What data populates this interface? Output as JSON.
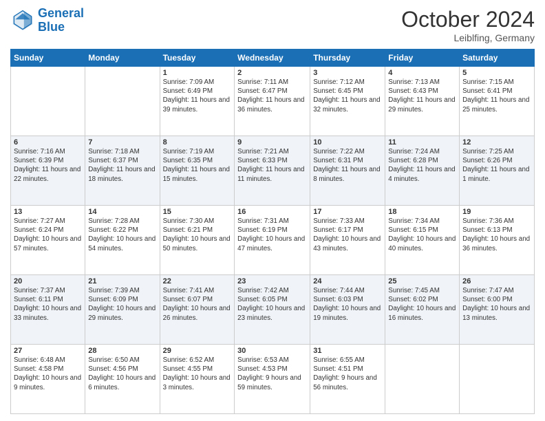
{
  "header": {
    "logo_line1": "General",
    "logo_line2": "Blue",
    "month_title": "October 2024",
    "location": "Leiblfing, Germany"
  },
  "days_of_week": [
    "Sunday",
    "Monday",
    "Tuesday",
    "Wednesday",
    "Thursday",
    "Friday",
    "Saturday"
  ],
  "weeks": [
    [
      {
        "day": "",
        "sunrise": "",
        "sunset": "",
        "daylight": ""
      },
      {
        "day": "",
        "sunrise": "",
        "sunset": "",
        "daylight": ""
      },
      {
        "day": "1",
        "sunrise": "Sunrise: 7:09 AM",
        "sunset": "Sunset: 6:49 PM",
        "daylight": "Daylight: 11 hours and 39 minutes."
      },
      {
        "day": "2",
        "sunrise": "Sunrise: 7:11 AM",
        "sunset": "Sunset: 6:47 PM",
        "daylight": "Daylight: 11 hours and 36 minutes."
      },
      {
        "day": "3",
        "sunrise": "Sunrise: 7:12 AM",
        "sunset": "Sunset: 6:45 PM",
        "daylight": "Daylight: 11 hours and 32 minutes."
      },
      {
        "day": "4",
        "sunrise": "Sunrise: 7:13 AM",
        "sunset": "Sunset: 6:43 PM",
        "daylight": "Daylight: 11 hours and 29 minutes."
      },
      {
        "day": "5",
        "sunrise": "Sunrise: 7:15 AM",
        "sunset": "Sunset: 6:41 PM",
        "daylight": "Daylight: 11 hours and 25 minutes."
      }
    ],
    [
      {
        "day": "6",
        "sunrise": "Sunrise: 7:16 AM",
        "sunset": "Sunset: 6:39 PM",
        "daylight": "Daylight: 11 hours and 22 minutes."
      },
      {
        "day": "7",
        "sunrise": "Sunrise: 7:18 AM",
        "sunset": "Sunset: 6:37 PM",
        "daylight": "Daylight: 11 hours and 18 minutes."
      },
      {
        "day": "8",
        "sunrise": "Sunrise: 7:19 AM",
        "sunset": "Sunset: 6:35 PM",
        "daylight": "Daylight: 11 hours and 15 minutes."
      },
      {
        "day": "9",
        "sunrise": "Sunrise: 7:21 AM",
        "sunset": "Sunset: 6:33 PM",
        "daylight": "Daylight: 11 hours and 11 minutes."
      },
      {
        "day": "10",
        "sunrise": "Sunrise: 7:22 AM",
        "sunset": "Sunset: 6:31 PM",
        "daylight": "Daylight: 11 hours and 8 minutes."
      },
      {
        "day": "11",
        "sunrise": "Sunrise: 7:24 AM",
        "sunset": "Sunset: 6:28 PM",
        "daylight": "Daylight: 11 hours and 4 minutes."
      },
      {
        "day": "12",
        "sunrise": "Sunrise: 7:25 AM",
        "sunset": "Sunset: 6:26 PM",
        "daylight": "Daylight: 11 hours and 1 minute."
      }
    ],
    [
      {
        "day": "13",
        "sunrise": "Sunrise: 7:27 AM",
        "sunset": "Sunset: 6:24 PM",
        "daylight": "Daylight: 10 hours and 57 minutes."
      },
      {
        "day": "14",
        "sunrise": "Sunrise: 7:28 AM",
        "sunset": "Sunset: 6:22 PM",
        "daylight": "Daylight: 10 hours and 54 minutes."
      },
      {
        "day": "15",
        "sunrise": "Sunrise: 7:30 AM",
        "sunset": "Sunset: 6:21 PM",
        "daylight": "Daylight: 10 hours and 50 minutes."
      },
      {
        "day": "16",
        "sunrise": "Sunrise: 7:31 AM",
        "sunset": "Sunset: 6:19 PM",
        "daylight": "Daylight: 10 hours and 47 minutes."
      },
      {
        "day": "17",
        "sunrise": "Sunrise: 7:33 AM",
        "sunset": "Sunset: 6:17 PM",
        "daylight": "Daylight: 10 hours and 43 minutes."
      },
      {
        "day": "18",
        "sunrise": "Sunrise: 7:34 AM",
        "sunset": "Sunset: 6:15 PM",
        "daylight": "Daylight: 10 hours and 40 minutes."
      },
      {
        "day": "19",
        "sunrise": "Sunrise: 7:36 AM",
        "sunset": "Sunset: 6:13 PM",
        "daylight": "Daylight: 10 hours and 36 minutes."
      }
    ],
    [
      {
        "day": "20",
        "sunrise": "Sunrise: 7:37 AM",
        "sunset": "Sunset: 6:11 PM",
        "daylight": "Daylight: 10 hours and 33 minutes."
      },
      {
        "day": "21",
        "sunrise": "Sunrise: 7:39 AM",
        "sunset": "Sunset: 6:09 PM",
        "daylight": "Daylight: 10 hours and 29 minutes."
      },
      {
        "day": "22",
        "sunrise": "Sunrise: 7:41 AM",
        "sunset": "Sunset: 6:07 PM",
        "daylight": "Daylight: 10 hours and 26 minutes."
      },
      {
        "day": "23",
        "sunrise": "Sunrise: 7:42 AM",
        "sunset": "Sunset: 6:05 PM",
        "daylight": "Daylight: 10 hours and 23 minutes."
      },
      {
        "day": "24",
        "sunrise": "Sunrise: 7:44 AM",
        "sunset": "Sunset: 6:03 PM",
        "daylight": "Daylight: 10 hours and 19 minutes."
      },
      {
        "day": "25",
        "sunrise": "Sunrise: 7:45 AM",
        "sunset": "Sunset: 6:02 PM",
        "daylight": "Daylight: 10 hours and 16 minutes."
      },
      {
        "day": "26",
        "sunrise": "Sunrise: 7:47 AM",
        "sunset": "Sunset: 6:00 PM",
        "daylight": "Daylight: 10 hours and 13 minutes."
      }
    ],
    [
      {
        "day": "27",
        "sunrise": "Sunrise: 6:48 AM",
        "sunset": "Sunset: 4:58 PM",
        "daylight": "Daylight: 10 hours and 9 minutes."
      },
      {
        "day": "28",
        "sunrise": "Sunrise: 6:50 AM",
        "sunset": "Sunset: 4:56 PM",
        "daylight": "Daylight: 10 hours and 6 minutes."
      },
      {
        "day": "29",
        "sunrise": "Sunrise: 6:52 AM",
        "sunset": "Sunset: 4:55 PM",
        "daylight": "Daylight: 10 hours and 3 minutes."
      },
      {
        "day": "30",
        "sunrise": "Sunrise: 6:53 AM",
        "sunset": "Sunset: 4:53 PM",
        "daylight": "Daylight: 9 hours and 59 minutes."
      },
      {
        "day": "31",
        "sunrise": "Sunrise: 6:55 AM",
        "sunset": "Sunset: 4:51 PM",
        "daylight": "Daylight: 9 hours and 56 minutes."
      },
      {
        "day": "",
        "sunrise": "",
        "sunset": "",
        "daylight": ""
      },
      {
        "day": "",
        "sunrise": "",
        "sunset": "",
        "daylight": ""
      }
    ]
  ]
}
